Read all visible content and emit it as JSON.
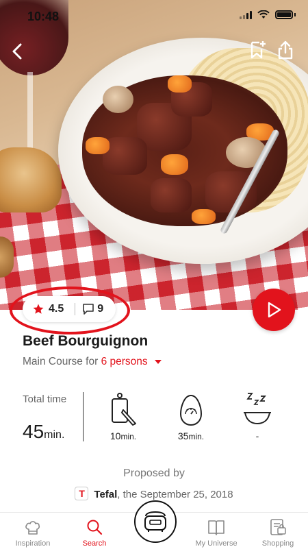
{
  "status_bar": {
    "time": "10:48"
  },
  "hero": {
    "image_alt": "Beef Bourguignon dish"
  },
  "nav": {
    "back_icon": "chevron-left-icon",
    "bookmark_icon": "bookmark-add-icon",
    "share_icon": "share-icon"
  },
  "rating": {
    "score": "4.5",
    "comments": "9"
  },
  "recipe": {
    "title": "Beef Bourguignon",
    "course_prefix": "Main Course for ",
    "persons": "6 persons"
  },
  "times": {
    "total_label": "Total time",
    "total_value": "45",
    "total_unit": "min.",
    "stages": [
      {
        "icon": "cutting-board-knife-icon",
        "value": "10",
        "unit": "min."
      },
      {
        "icon": "egg-timer-icon",
        "value": "35",
        "unit": "min."
      },
      {
        "icon": "resting-bowl-icon",
        "value": "-",
        "unit": ""
      }
    ]
  },
  "proposed": {
    "label": "Proposed by",
    "brand": "Tefal",
    "date_text": ", the September 25, 2018"
  },
  "tabs": [
    {
      "label": "Inspiration",
      "icon": "chef-hat-icon",
      "active": false
    },
    {
      "label": "Search",
      "icon": "search-icon",
      "active": true
    },
    {
      "label": "My Universe",
      "icon": "book-icon",
      "active": false
    },
    {
      "label": "Shopping",
      "icon": "shopping-list-icon",
      "active": false
    }
  ],
  "colors": {
    "accent": "#e2131c"
  }
}
